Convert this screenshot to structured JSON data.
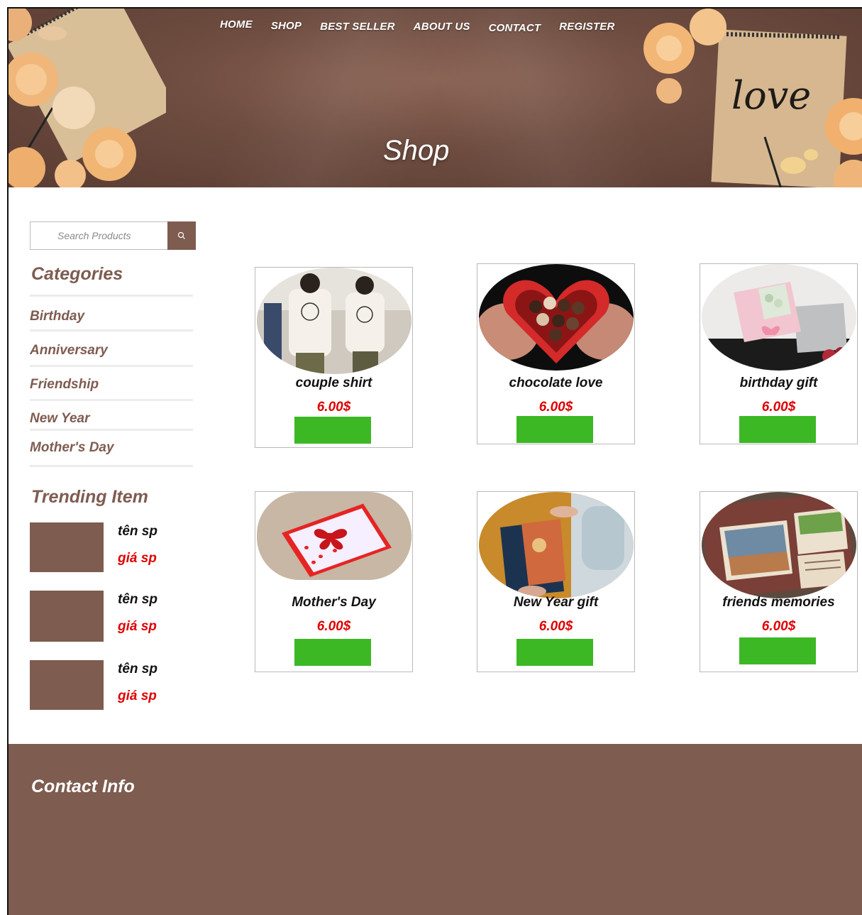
{
  "nav": [
    "HOME",
    "SHOP",
    "BEST SELLER",
    "ABOUT US",
    "CONTACT",
    "REGISTER"
  ],
  "hero": {
    "title": "Shop",
    "notebook_lettering": "love"
  },
  "search": {
    "placeholder": "Search Products",
    "icon": "search-icon"
  },
  "categories": {
    "heading": "Categories",
    "items": [
      "Birthday",
      "Anniversary",
      "Friendship",
      "New Year",
      "Mother's Day"
    ]
  },
  "trending": {
    "heading": "Trending Item",
    "items": [
      {
        "name": "tên sp",
        "price": "giá sp"
      },
      {
        "name": "tên sp",
        "price": "giá sp"
      },
      {
        "name": "tên sp",
        "price": "giá sp"
      }
    ]
  },
  "products": [
    {
      "title": "couple shirt",
      "price": "6.00$"
    },
    {
      "title": "chocolate love",
      "price": "6.00$"
    },
    {
      "title": "birthday gift",
      "price": "6.00$"
    },
    {
      "title": "Mother's Day",
      "price": "6.00$"
    },
    {
      "title": "New Year gift",
      "price": "6.00$"
    },
    {
      "title": "friends memories",
      "price": "6.00$"
    }
  ],
  "footer": {
    "heading": "Contact Info"
  },
  "colors": {
    "brand": "#7e5c50",
    "price": "#e00000",
    "buy_button": "#3cb825",
    "hero_bg": "#6e4c40"
  }
}
